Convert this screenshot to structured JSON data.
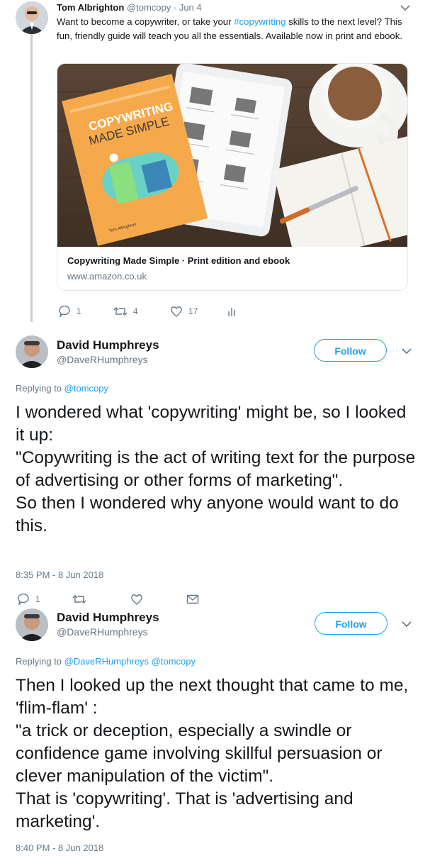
{
  "tweet1": {
    "author_name": "Tom Albrighton",
    "handle": "@tomcopy",
    "date": "· Jun 4",
    "text_before": "Want to become a copywriter, or take your ",
    "hashtag": "#copywriting",
    "text_after": " skills to the next level? This fun, friendly guide will teach you all the essentials. Available now in print and ebook.",
    "card": {
      "title": "Copywriting Made Simple · Print edition and ebook",
      "url": "www.amazon.co.uk",
      "book_title_line1": "COPYWRITING",
      "book_title_line2": "MADE SIMPLE",
      "book_subtitle": "How to write powerful and persuasive copy that sells",
      "book_author": "Tom Albrighton"
    },
    "actions": {
      "replies": "1",
      "retweets": "4",
      "likes": "17"
    }
  },
  "reply1": {
    "author_name": "David Humphreys",
    "handle": "@DaveRHumphreys",
    "follow_label": "Follow",
    "replying_prefix": "Replying to ",
    "replying_to": "@tomcopy",
    "text": "I wondered what 'copywriting' might be, so I looked it up:\n\"Copywriting is the act of writing text for the purpose of advertising or other forms of marketing\".\nSo then I wondered why anyone would want to do this.",
    "timestamp": "8:35 PM - 8 Jun 2018",
    "actions": {
      "replies": "1"
    }
  },
  "reply2": {
    "author_name": "David Humphreys",
    "handle": "@DaveRHumphreys",
    "follow_label": "Follow",
    "replying_prefix": "Replying to ",
    "replying_to": "@DaveRHumphreys @tomcopy",
    "text": "Then I looked up the next thought that came to me, 'flim-flam' :\n\"a trick or deception, especially a swindle or confidence game involving skillful persuasion or clever manipulation of the victim\".\nThat is 'copywriting'. That is 'advertising and marketing'.",
    "timestamp": "8:40 PM - 8 Jun 2018"
  },
  "colors": {
    "accent": "#1da1f2",
    "muted": "#657786",
    "thread_line": "#c4cfd6",
    "book_orange": "#f6a94b"
  }
}
